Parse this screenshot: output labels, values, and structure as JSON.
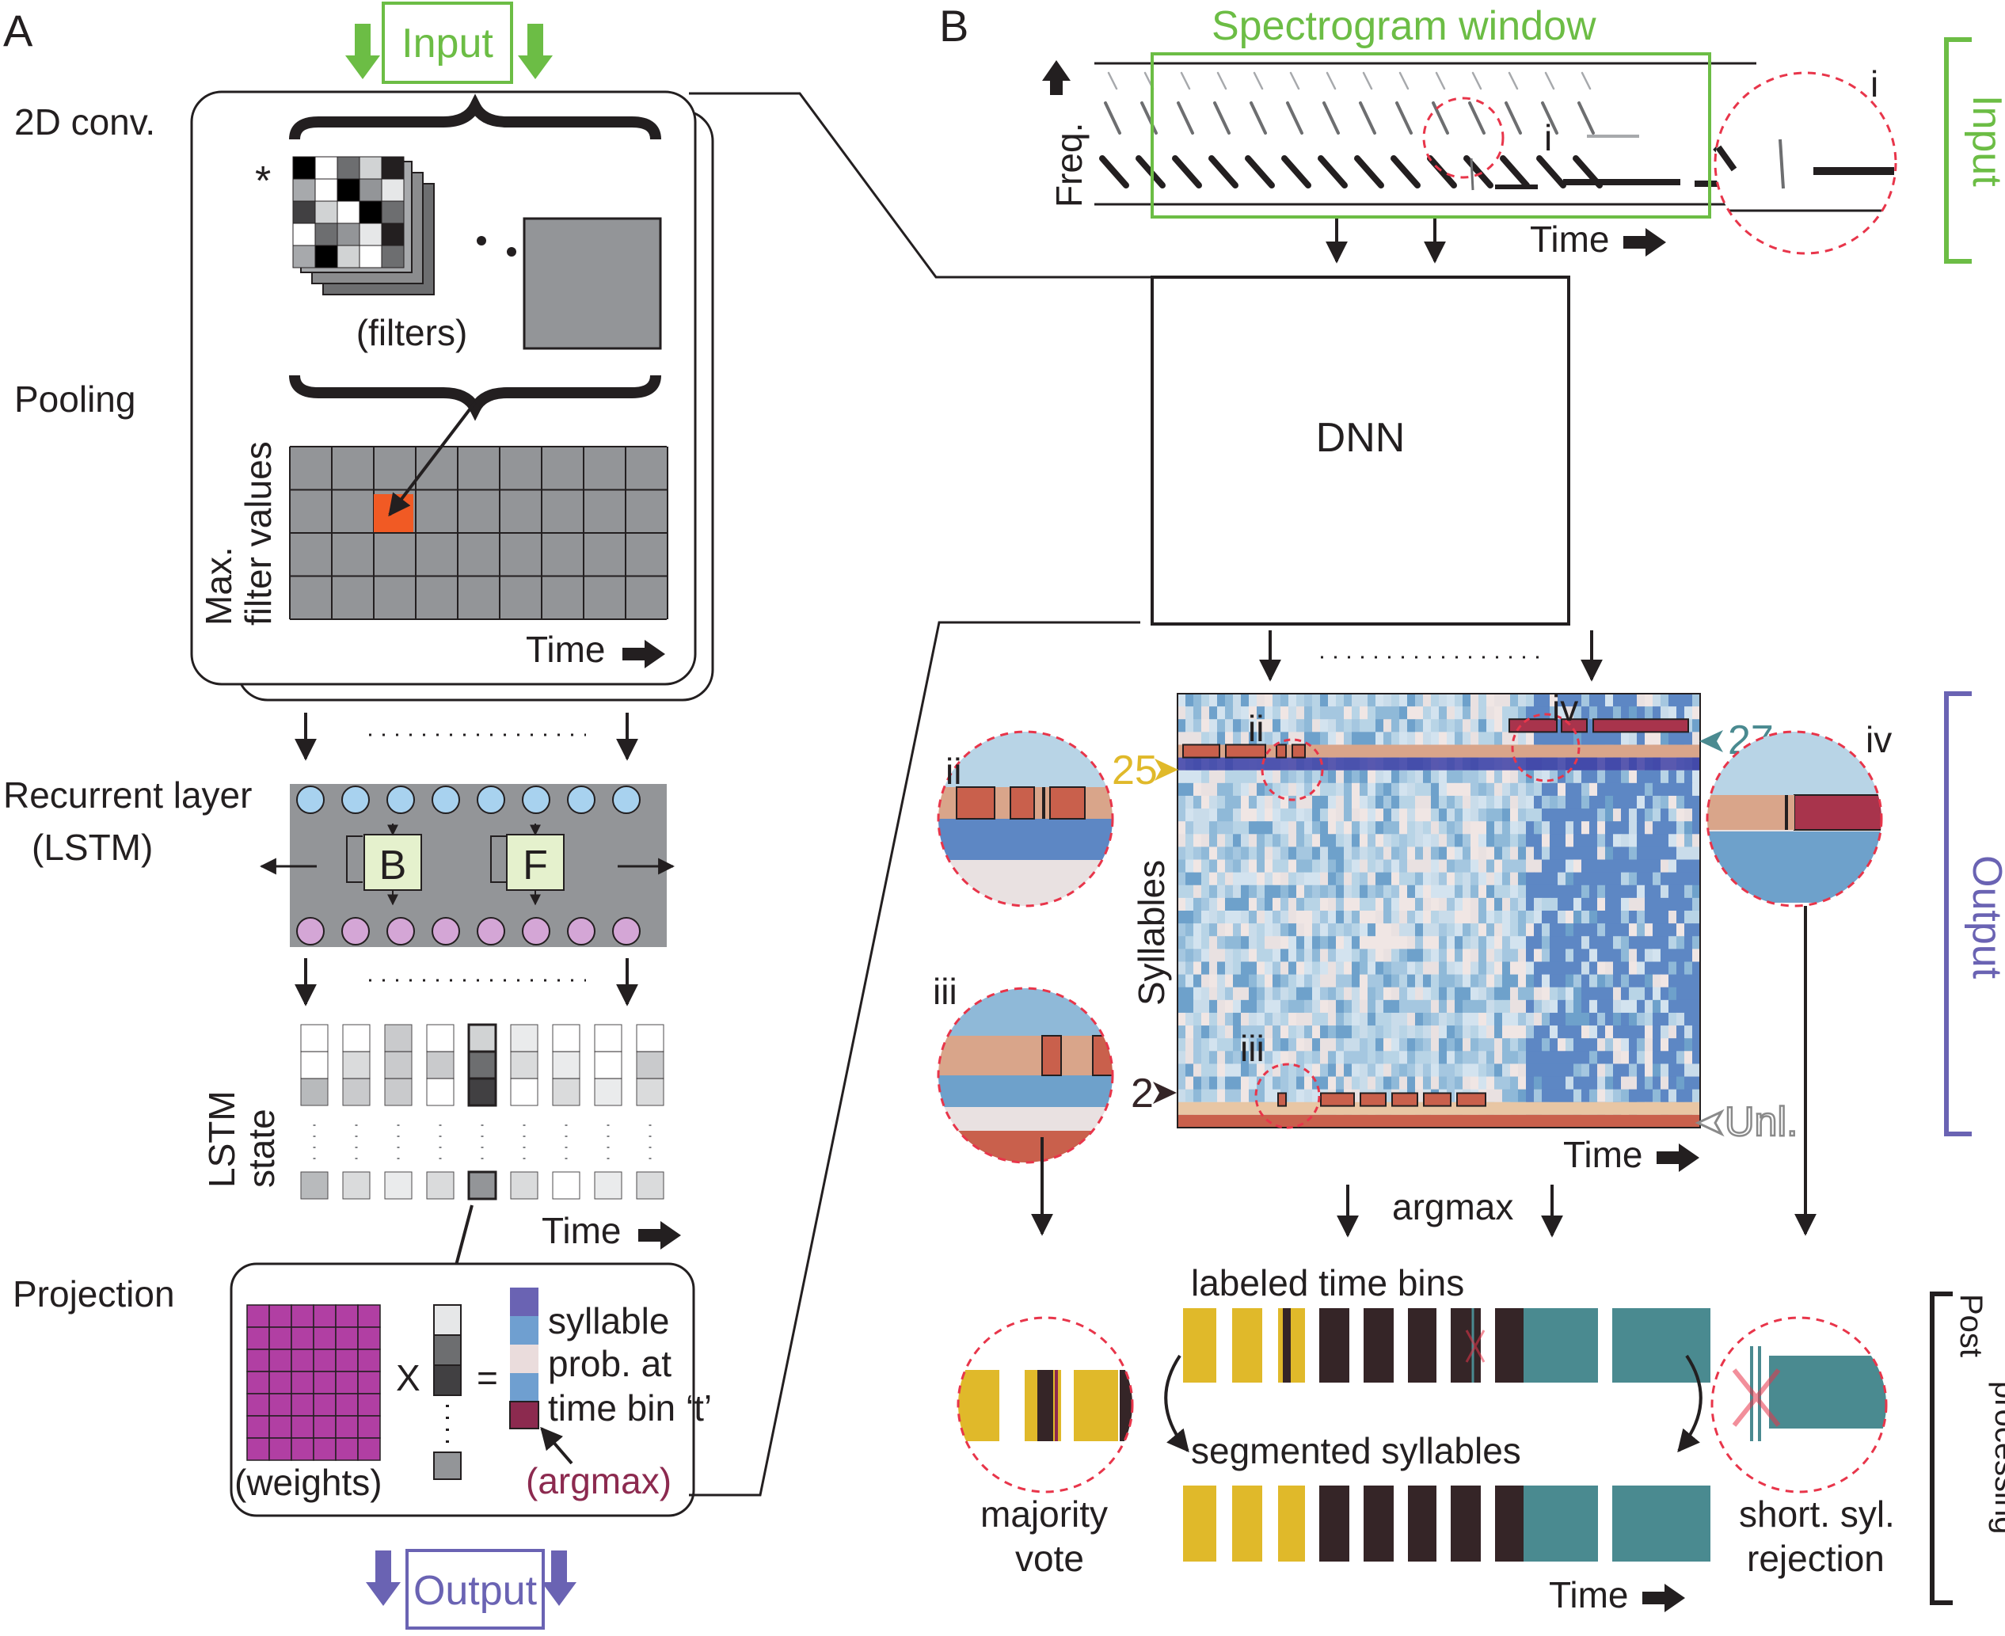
{
  "panels": {
    "a": "A",
    "b": "B"
  },
  "colors": {
    "input_green": "#6cbd45",
    "output_purple": "#6a63b3",
    "pool_orange": "#f15a24",
    "lstm_top": "#a8d2ef",
    "lstm_bottom": "#d4a6d6",
    "gate_fill": "#e5f1cd",
    "weights_magenta": "#b13fa3",
    "argmax_maroon": "#8c2a4f",
    "syllable_yellow": "#e0b92a",
    "syllable_dark": "#352527",
    "syllable_teal": "#4a8a90",
    "dashed_red": "#e8354a",
    "label_25": "#e0b92a",
    "label_27": "#4a8a90",
    "label_2": "#352527",
    "label_unl": "#8a8a8a"
  },
  "panel_a": {
    "input_label": "Input",
    "conv_label": "2D conv.",
    "star": "*",
    "filters_label": "(filters)",
    "pooling_label": "Pooling",
    "max_label_line1": "Max.",
    "max_label_line2": "filter values",
    "time_label": "Time",
    "recurrent_label_line1": "Recurrent layer",
    "recurrent_label_line2": "(LSTM)",
    "gate_b": "B",
    "gate_f": "F",
    "lstm_state_line1": "LSTM",
    "lstm_state_line2": "state",
    "projection_label": "Projection",
    "weights_label": "(weights)",
    "times_sign": "X",
    "equals_sign": "=",
    "prob_line1": "syllable",
    "prob_line2": "prob. at",
    "prob_line3": "time bin ‘t’",
    "argmax_label": "(argmax)",
    "output_label": "Output"
  },
  "panel_b": {
    "spectrogram_window_label": "Spectrogram window",
    "freq_label": "Freq.",
    "time_label": "Time",
    "dnn_label": "DNN",
    "zoom_i": "i",
    "zoom_ii": "ii",
    "zoom_iii": "iii",
    "zoom_iv": "iv",
    "syllables_axis": "Syllables",
    "class_25": "25",
    "class_27": "27",
    "class_2": "2",
    "class_unl": "Unl.",
    "argmax_label": "argmax",
    "labeled_bins_label": "labeled time bins",
    "segmented_label": "segmented syllables",
    "majority_line1": "majority",
    "majority_line2": "vote",
    "reject_line1": "short. syl.",
    "reject_line2": "rejection",
    "side_input": "Input",
    "side_output": "Output",
    "side_post_line1": "Post",
    "side_post_line2": "processing"
  }
}
